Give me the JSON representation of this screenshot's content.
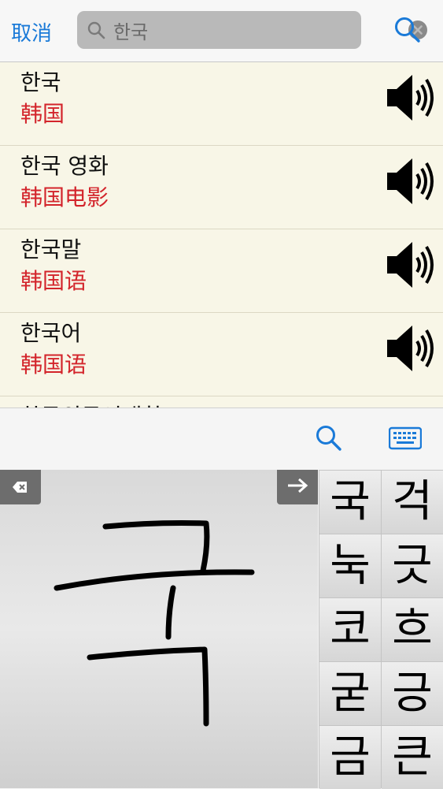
{
  "search": {
    "cancel_label": "取消",
    "query": "한국"
  },
  "results": [
    {
      "korean": "한국",
      "chinese": "韩国"
    },
    {
      "korean": "한국 영화",
      "chinese": "韩国电影"
    },
    {
      "korean": "한국말",
      "chinese": "韩国语"
    },
    {
      "korean": "한국어",
      "chinese": "韩国语"
    },
    {
      "korean": "한국외국어대학교",
      "chinese": ""
    }
  ],
  "candidates": [
    "국",
    "걱",
    "눅",
    "긋",
    "코",
    "흐",
    "굳",
    "긍",
    "금",
    "큰"
  ],
  "icons": {
    "search": "search-icon",
    "clear": "clear-icon",
    "speaker": "speaker-icon",
    "keyboard": "keyboard-icon",
    "delete": "delete-icon",
    "next": "arrow-right-icon"
  },
  "colors": {
    "accent": "#1a7ad8",
    "translation": "#d3242b",
    "list_bg": "#f8f6e7"
  }
}
